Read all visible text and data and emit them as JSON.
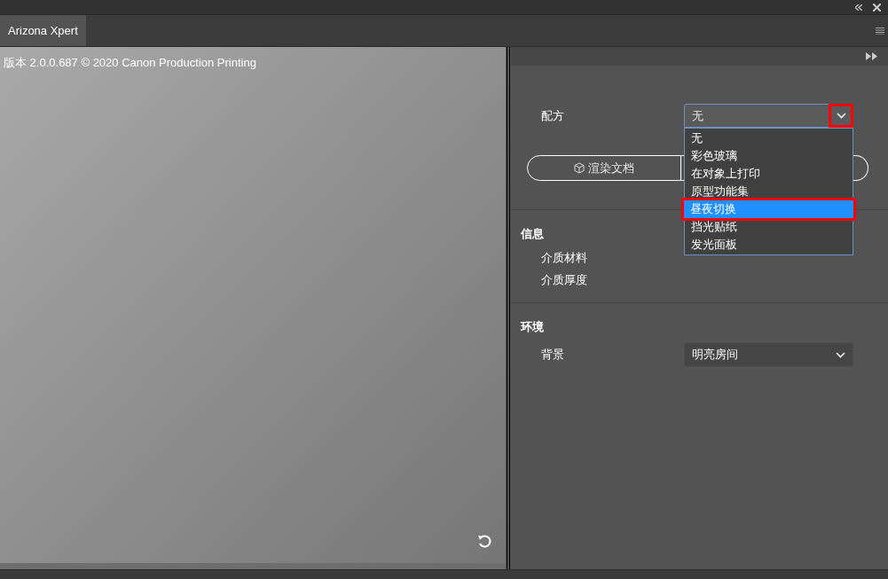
{
  "tabs": [
    {
      "label": "Arizona Xpert",
      "selected": true
    }
  ],
  "preview": {
    "version": "版本 2.0.0.687 © 2020 Canon Production Printing"
  },
  "recipe": {
    "label": "配方",
    "value": "无",
    "expanded": true,
    "callout": true,
    "options": [
      {
        "label": "无",
        "highlighted": false,
        "callout": false
      },
      {
        "label": "彩色玻璃",
        "highlighted": false,
        "callout": false
      },
      {
        "label": "在对象上打印",
        "highlighted": false,
        "callout": false
      },
      {
        "label": "原型功能集",
        "highlighted": false,
        "callout": false
      },
      {
        "label": "昼夜切换",
        "highlighted": true,
        "callout": true
      },
      {
        "label": "挡光贴纸",
        "highlighted": false,
        "callout": false
      },
      {
        "label": "发光面板",
        "highlighted": false,
        "callout": false
      }
    ]
  },
  "buttons": [
    {
      "label": "渲染文档"
    }
  ],
  "info": {
    "title": "信息",
    "fields": [
      "介质材料",
      "介质厚度"
    ]
  },
  "environment": {
    "title": "环境",
    "background": {
      "label": "背景",
      "value": "明亮房间"
    }
  }
}
